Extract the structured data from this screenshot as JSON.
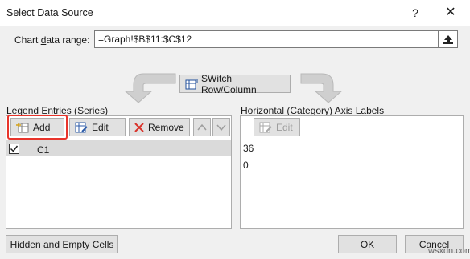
{
  "window": {
    "title": "Select Data Source",
    "help_glyph": "?",
    "close_glyph": "✕"
  },
  "range": {
    "label_pre": "Chart ",
    "label_key": "d",
    "label_post": "ata range:",
    "value": "=Graph!$B$11:$C$12"
  },
  "switch_button": {
    "key": "W",
    "label_post": "itch Row/Column",
    "label_pre": "S"
  },
  "legend": {
    "title_pre": "Legend Entries (",
    "title_key": "S",
    "title_post": "eries)",
    "add_key": "A",
    "add_post": "dd",
    "edit_key": "E",
    "edit_post": "dit",
    "remove_key": "R",
    "remove_post": "emove",
    "series": [
      {
        "name": "C1",
        "checked": true
      }
    ]
  },
  "axis": {
    "title_pre": "Horizontal (",
    "title_key": "C",
    "title_post": "ategory) Axis Labels",
    "edit_pre": "Edi",
    "edit_key": "t",
    "labels": [
      "36",
      "0"
    ]
  },
  "footer": {
    "hidden_key": "H",
    "hidden_post": "idden and Empty Cells",
    "ok": "OK",
    "cancel": "Cancel"
  },
  "watermark": "wsxdn.com",
  "colors": {
    "highlight": "#e8342b",
    "remove_x": "#d9322a",
    "arrow": "#c8c8c8"
  }
}
